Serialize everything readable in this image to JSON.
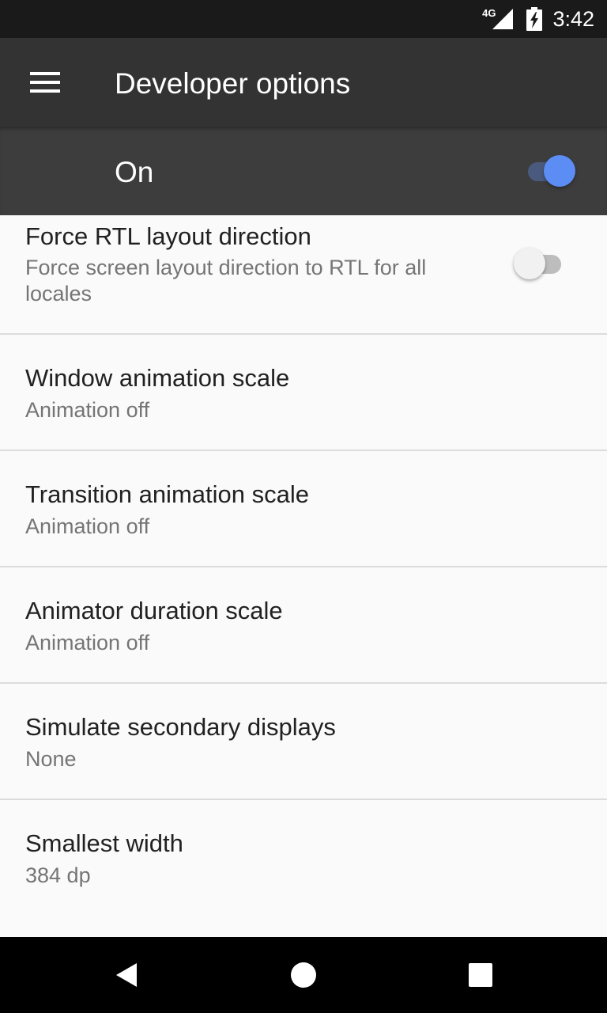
{
  "status_bar": {
    "network": "4G",
    "time": "3:42",
    "icons": [
      "signal-icon",
      "battery-icon"
    ]
  },
  "toolbar": {
    "title": "Developer options",
    "menu_icon": "menu-icon"
  },
  "master_switch": {
    "label": "On",
    "checked": true
  },
  "settings": [
    {
      "title": "Force RTL layout direction",
      "summary": "Force screen layout direction to RTL for all locales",
      "toggle": false
    },
    {
      "title": "Window animation scale",
      "summary": "Animation off"
    },
    {
      "title": "Transition animation scale",
      "summary": "Animation off"
    },
    {
      "title": "Animator duration scale",
      "summary": "Animation off"
    },
    {
      "title": "Simulate secondary displays",
      "summary": "None"
    },
    {
      "title": "Smallest width",
      "summary": "384 dp"
    }
  ],
  "nav_bar": {
    "icons": [
      "back-icon",
      "home-icon",
      "recents-icon"
    ]
  },
  "colors": {
    "accent": "#5c8df5",
    "toolbar": "#333333",
    "master_bar": "#3d3d3d",
    "background": "#fafafa"
  }
}
